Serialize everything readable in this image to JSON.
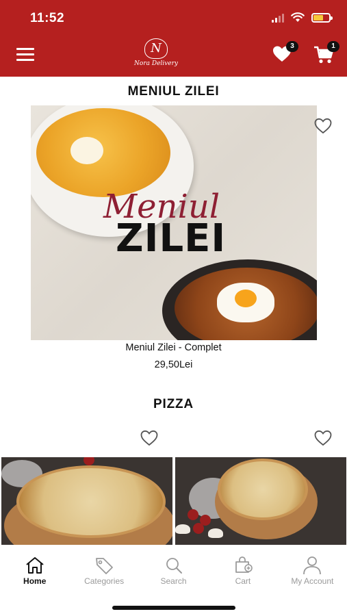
{
  "status_bar": {
    "time": "11:52"
  },
  "header": {
    "brand_logo": "Nora Delivery",
    "favorites_count": "3",
    "cart_count": "1",
    "colors": {
      "accent": "#b5201f"
    }
  },
  "daily_menu": {
    "section_title": "MENIUL ZILEI",
    "banner_script": "Meniul",
    "banner_big": "ZILEI",
    "product_name": "Meniul Zilei - Complet",
    "price": "29,50Lei"
  },
  "pizza": {
    "section_title": "PIZZA"
  },
  "tabbar": {
    "items": [
      {
        "label": "Home",
        "icon": "home-icon",
        "active": true
      },
      {
        "label": "Categories",
        "icon": "tag-icon",
        "active": false
      },
      {
        "label": "Search",
        "icon": "search-icon",
        "active": false
      },
      {
        "label": "Cart",
        "icon": "bag-icon",
        "active": false
      },
      {
        "label": "My Account",
        "icon": "user-icon",
        "active": false
      }
    ]
  }
}
